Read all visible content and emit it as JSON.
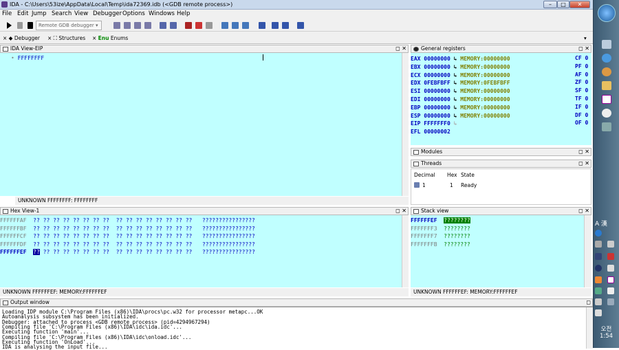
{
  "window": {
    "title": "IDA - C:\\Users\\53ize\\AppData\\Local\\Temp\\ida72369.idb (<GDB remote process>)"
  },
  "menu": [
    "File",
    "Edit",
    "Jump",
    "Search",
    "View",
    "Debugger",
    "Options",
    "Windows",
    "Help"
  ],
  "toolbar": {
    "debugger_select": "Remote GDB debugger"
  },
  "tabs": [
    {
      "label": "Debugger"
    },
    {
      "label": "Structures"
    },
    {
      "label": "Enums"
    }
  ],
  "ida_view": {
    "title": "IDA View-EIP",
    "line": "FFFFFFFF",
    "status": "UNKNOWN  FFFFFFFF: FFFFFFFF"
  },
  "registers": {
    "title": "General registers",
    "rows": [
      {
        "name": "EAX",
        "value": "00000000",
        "ref": "MEMORY:00000000"
      },
      {
        "name": "EBX",
        "value": "00000000",
        "ref": "MEMORY:00000000"
      },
      {
        "name": "ECX",
        "value": "00000000",
        "ref": "MEMORY:00000000"
      },
      {
        "name": "EDX",
        "value": "0FEBFBFF",
        "ref": "MEMORY:0FEBFBFF"
      },
      {
        "name": "ESI",
        "value": "00000000",
        "ref": "MEMORY:00000000"
      },
      {
        "name": "EDI",
        "value": "00000000",
        "ref": "MEMORY:00000000"
      },
      {
        "name": "EBP",
        "value": "00000000",
        "ref": "MEMORY:00000000"
      },
      {
        "name": "ESP",
        "value": "00000000",
        "ref": "MEMORY:00000000"
      },
      {
        "name": "EIP",
        "value": "FFFFFFF0",
        "ref": ""
      },
      {
        "name": "EFL",
        "value": "00000002",
        "ref": ""
      }
    ],
    "flags": [
      {
        "name": "CF",
        "value": "0"
      },
      {
        "name": "PF",
        "value": "0"
      },
      {
        "name": "AF",
        "value": "0"
      },
      {
        "name": "ZF",
        "value": "0"
      },
      {
        "name": "SF",
        "value": "0"
      },
      {
        "name": "TF",
        "value": "0"
      },
      {
        "name": "IF",
        "value": "0"
      },
      {
        "name": "DF",
        "value": "0"
      },
      {
        "name": "OF",
        "value": "0"
      }
    ]
  },
  "modules": {
    "title": "Modules"
  },
  "threads": {
    "title": "Threads",
    "headers": [
      "Decimal",
      "Hex",
      "State"
    ],
    "rows": [
      {
        "decimal": "1",
        "hex": "1",
        "state": "Ready"
      }
    ]
  },
  "hex_view": {
    "title": "Hex View-1",
    "rows": [
      {
        "addr": "FFFFFFAF",
        "bytes": "?? ?? ?? ?? ?? ?? ?? ??  ?? ?? ?? ?? ?? ?? ?? ??",
        "ascii": "????????????????"
      },
      {
        "addr": "FFFFFFBF",
        "bytes": "?? ?? ?? ?? ?? ?? ?? ??  ?? ?? ?? ?? ?? ?? ?? ??",
        "ascii": "????????????????"
      },
      {
        "addr": "FFFFFFCF",
        "bytes": "?? ?? ?? ?? ?? ?? ?? ??  ?? ?? ?? ?? ?? ?? ?? ??",
        "ascii": "????????????????"
      },
      {
        "addr": "FFFFFFDF",
        "bytes": "?? ?? ?? ?? ?? ?? ?? ??  ?? ?? ?? ?? ?? ?? ?? ??",
        "ascii": "????????????????"
      },
      {
        "addr": "FFFFFFEF",
        "sel": "??",
        "bytes": " ?? ?? ?? ?? ?? ?? ??  ?? ?? ?? ?? ?? ?? ?? ??",
        "ascii": "????????????????"
      }
    ],
    "status": "UNKNOWN  FFFFFFEF: MEMORY:FFFFFFEF"
  },
  "stack_view": {
    "title": "Stack view",
    "rows": [
      {
        "addr": "FFFFFFEF",
        "value": "????????"
      },
      {
        "addr": "FFFFFFF3",
        "value": "????????"
      },
      {
        "addr": "FFFFFFF7",
        "value": "????????"
      },
      {
        "addr": "FFFFFFFB",
        "value": "????????"
      }
    ],
    "status": "UNKNOWN  FFFFFFEF: MEMORY:FFFFFFEF"
  },
  "output": {
    "title": "Output window",
    "lines": [
      "Loading IDP module C:\\Program Files (x86)\\IDA\\procs\\pc.w32 for processor metapc...OK",
      "Autoanalysis subsystem has been initialized.",
      "Debugger: attached to process <GDB remote process> (pid=4294967294)",
      "Compiling file 'C:\\Program Files (x86)\\IDA\\idc\\ida.idc'...",
      "Executing function 'main'...",
      "Compiling file 'C:\\Program Files (x86)\\IDA\\idc\\onload.idc'...",
      "Executing function 'OnLoad'...",
      "IDA is analysing the input file..."
    ]
  },
  "taskbar": {
    "clock": "오전 1:54",
    "ime": "A 漢"
  },
  "colors": {
    "pane_bg": "#c0ffff",
    "reg_blue": "#0000c0",
    "ref_olive": "#808000",
    "stack_green": "#008000"
  }
}
